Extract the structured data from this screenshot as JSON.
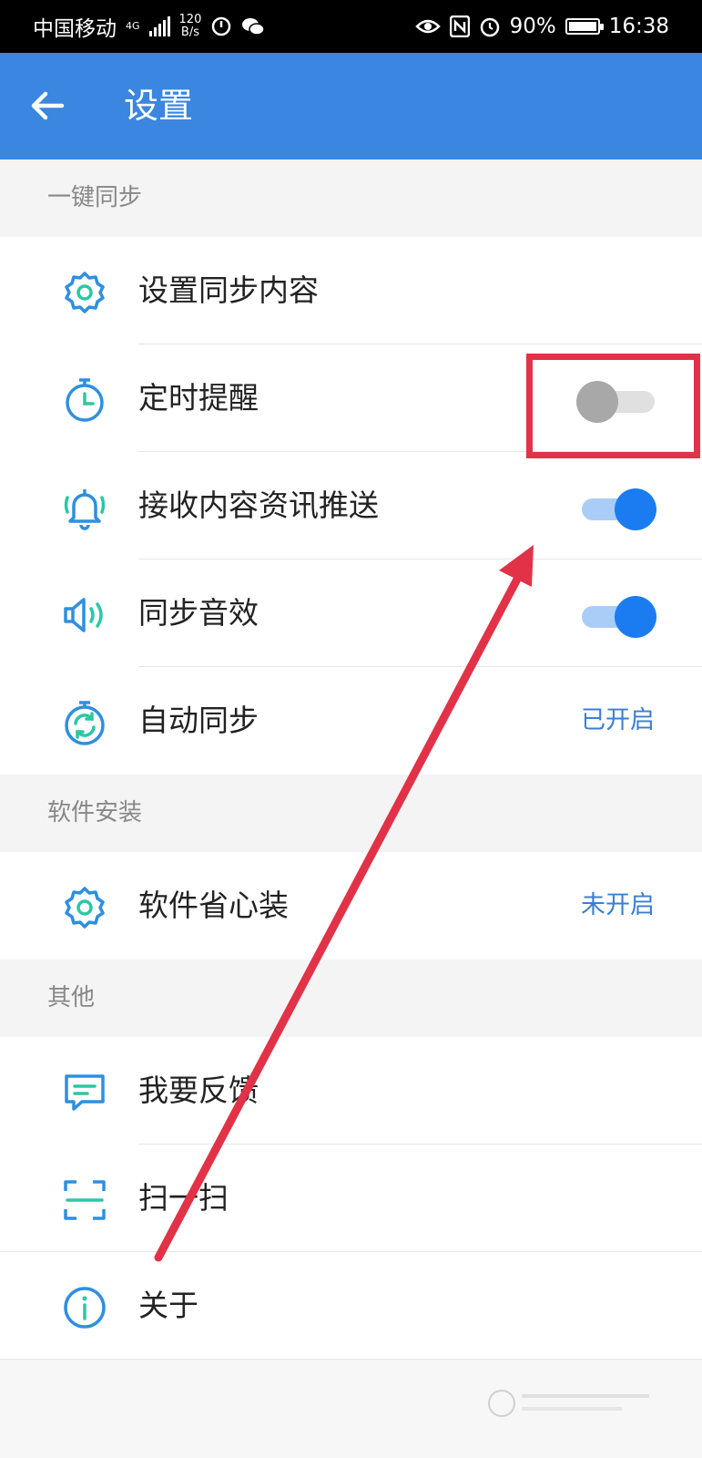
{
  "statusbar": {
    "carrier": "中国移动",
    "network_type": "4G",
    "net_speed_value": "120",
    "net_speed_unit": "B/s",
    "battery": "90%",
    "time": "16:38"
  },
  "appbar": {
    "title": "设置"
  },
  "sections": {
    "sync": {
      "header": "一键同步",
      "items": [
        {
          "label": "设置同步内容"
        },
        {
          "label": "定时提醒",
          "toggle": "off"
        },
        {
          "label": "接收内容资讯推送",
          "toggle": "on"
        },
        {
          "label": "同步音效",
          "toggle": "on"
        },
        {
          "label": "自动同步",
          "status": "已开启"
        }
      ]
    },
    "software": {
      "header": "软件安装",
      "items": [
        {
          "label": "软件省心装",
          "status": "未开启"
        }
      ]
    },
    "other": {
      "header": "其他",
      "items": [
        {
          "label": "我要反馈"
        },
        {
          "label": "扫一扫"
        },
        {
          "label": "关于"
        }
      ]
    }
  },
  "annotation": {
    "color": "#e23247"
  },
  "colors": {
    "appbar": "#3a86e0",
    "accent": "#1a7cf0",
    "status_text": "#3a7fd0"
  }
}
